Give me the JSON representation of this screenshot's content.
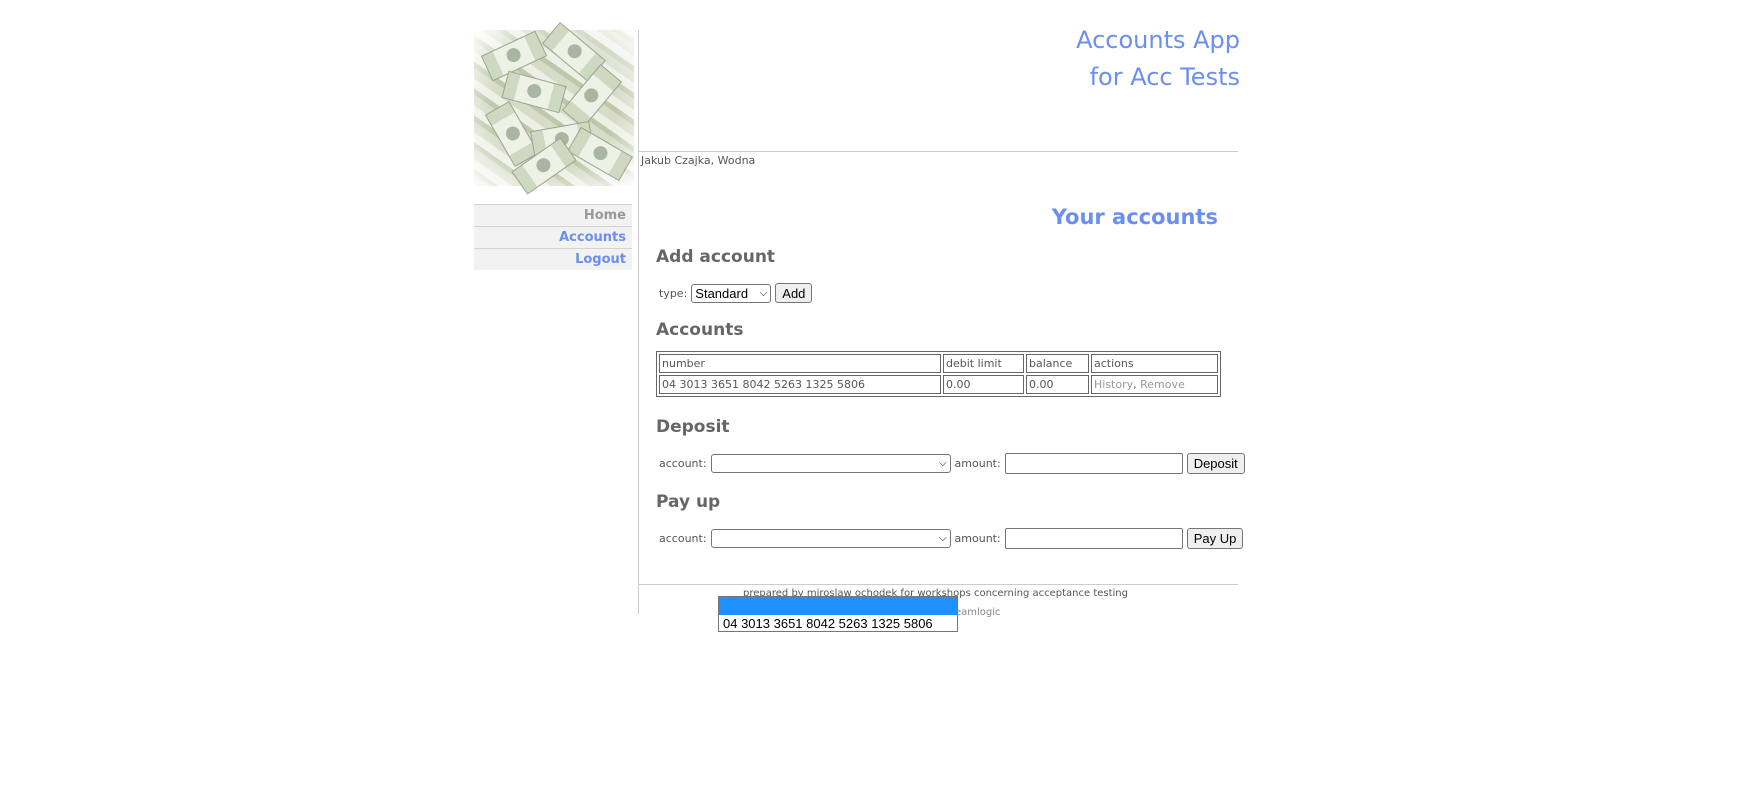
{
  "header": {
    "title_line1": "Accounts App",
    "title_line2": "for Acc Tests"
  },
  "user": {
    "display": "Jakub Czajka, Wodna"
  },
  "nav": {
    "items": [
      {
        "label": "Home"
      },
      {
        "label": "Accounts"
      },
      {
        "label": "Logout"
      }
    ]
  },
  "page_title": "Your accounts",
  "add_account": {
    "title": "Add account",
    "type_label": "type:",
    "type_value": "Standard",
    "add_button": "Add"
  },
  "accounts": {
    "title": "Accounts",
    "columns": [
      "number",
      "debit limit",
      "balance",
      "actions"
    ],
    "rows": [
      {
        "number": "04 3013 3651 8042 5263 1325 5806",
        "debit_limit": "0.00",
        "balance": "0.00",
        "history": "History",
        "separator": ",",
        "remove": "Remove"
      }
    ]
  },
  "deposit": {
    "title": "Deposit",
    "account_label": "account:",
    "account_value": "",
    "amount_label": "amount:",
    "amount_value": "",
    "button": "Deposit"
  },
  "payup": {
    "title": "Pay up",
    "account_label": "account:",
    "account_value": "",
    "amount_label": "amount:",
    "amount_value": "",
    "button": "Pay Up"
  },
  "footer": {
    "line1": "prepared by miroslaw ochodek for workshops concerning acceptance testing",
    "line2": "eamlogic"
  },
  "open_dropdown": {
    "options": [
      "",
      "04 3013 3651 8042 5263 1325 5806"
    ]
  },
  "colors": {
    "accent": "#6b8ff0",
    "highlight": "#1e90ff"
  }
}
